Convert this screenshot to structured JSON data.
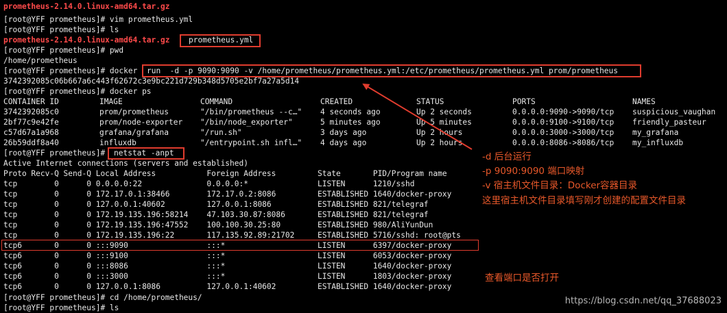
{
  "terminal": {
    "lines": {
      "l0": "prometheus-2.14.0.linux-amd64.tar.gz",
      "l1": "[root@YFF prometheus]# vim prometheus.yml",
      "l2": "[root@YFF prometheus]# ls",
      "l3a": "prometheus-2.14.0.linux-amd64.tar.gz",
      "l3b": "prometheus.yml",
      "l4": "[root@YFF prometheus]# pwd",
      "l5": "/home/prometheus",
      "l6a": "[root@YFF prometheus]# docker ",
      "l6b": "run  -d -p 9090:9090 -v /home/prometheus/prometheus.yml:/etc/prometheus/prometheus.yml prom/prometheus",
      "l7": "3742392085c06b667a6c443f62672c3e9bc221d729b348d5705e2bf7a27a5d14",
      "l8": "[root@YFF prometheus]# docker ps",
      "l15a": "[root@YFF prometheus]# ",
      "l15b": "netstat -anpt",
      "l16": "Active Internet connections (servers and established)",
      "l17": "Proto Recv-Q Send-Q Local Address           Foreign Address         State       PID/Program name",
      "l27": "[root@YFF prometheus]# cd /home/prometheus/",
      "l28": "[root@YFF prometheus]# ls"
    },
    "docker_ps": {
      "headers": [
        "CONTAINER ID",
        "IMAGE",
        "COMMAND",
        "CREATED",
        "STATUS",
        "PORTS",
        "NAMES"
      ],
      "rows": [
        [
          "3742392085c0",
          "prom/prometheus",
          "\"/bin/prometheus --c…\"",
          "4 seconds ago",
          "Up 2 seconds",
          "0.0.0.0:9090->9090/tcp",
          "suspicious_vaughan"
        ],
        [
          "2bf77c9e42fe",
          "prom/node-exporter",
          "\"/bin/node_exporter\"",
          "5 minutes ago",
          "Up 5 minutes",
          "0.0.0.0:9100->9100/tcp",
          "friendly_pasteur"
        ],
        [
          "c57d67a1a968",
          "grafana/grafana",
          "\"/run.sh\"",
          "3 days ago",
          "Up 2 hours",
          "0.0.0.0:3000->3000/tcp",
          "my_grafana"
        ],
        [
          "26b59ddf8a40",
          "influxdb",
          "\"/entrypoint.sh infl…\"",
          "4 days ago",
          "Up 2 hours",
          "0.0.0.0:8086->8086/tcp",
          "my_influxdb"
        ]
      ]
    },
    "netstat": [
      "tcp        0      0 0.0.0.0:22              0.0.0.0:*               LISTEN      1210/sshd",
      "tcp        0      0 172.17.0.1:38466        172.17.0.2:8086         ESTABLISHED 1640/docker-proxy",
      "tcp        0      0 127.0.0.1:40602         127.0.0.1:8086          ESTABLISHED 821/telegraf",
      "tcp        0      0 172.19.135.196:58214    47.103.30.87:8086       ESTABLISHED 821/telegraf",
      "tcp        0      0 172.19.135.196:47552    100.100.30.25:80        ESTABLISHED 980/AliYunDun",
      "tcp        0      0 172.19.135.196:22       117.135.92.89:21702     ESTABLISHED 5716/sshd: root@pts",
      "tcp6       0      0 :::9090                 :::*                    LISTEN      6397/docker-proxy",
      "tcp6       0      0 :::9100                 :::*                    LISTEN      6053/docker-proxy",
      "tcp6       0      0 :::8086                 :::*                    LISTEN      1640/docker-proxy",
      "tcp6       0      0 :::3000                 :::*                    LISTEN      1803/docker-proxy",
      "tcp6       0      0 127.0.0.1:8086          127.0.0.1:40602         ESTABLISHED 1640/docker-proxy"
    ]
  },
  "annotations": {
    "a1": "-d 后台运行",
    "a2": "-p 9090:9090 端口映射",
    "a3": "-v 宿主机文件目录：Docker容器目录",
    "a4": "这里宿主机文件目录填写刚才创建的配置文件目录",
    "a5": "查看端口是否打开"
  },
  "watermark": "https://blog.csdn.net/qq_37688023",
  "colors": {
    "background": "#000000",
    "text": "#e8e8e8",
    "archive": "#ff4a4a",
    "highlight_box": "#e03c2e",
    "annotation": "#e8582a"
  }
}
